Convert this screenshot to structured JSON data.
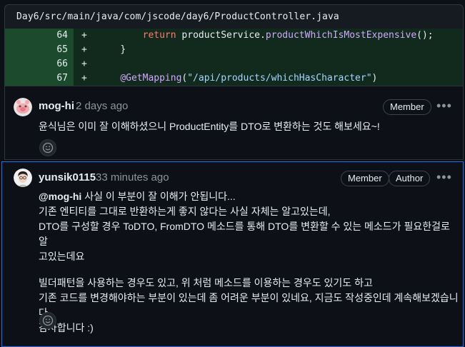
{
  "file": {
    "path": "Day6/src/main/java/com/jscode/day6/ProductController.java"
  },
  "diff": {
    "rows": [
      {
        "line": "64",
        "sign": "+",
        "indent": "        ",
        "tokens": [
          "return",
          " productService.",
          "productWhichIsMostExpensive",
          "();"
        ]
      },
      {
        "line": "65",
        "sign": "+",
        "indent": "    ",
        "tokens": [
          "}"
        ]
      },
      {
        "line": "66",
        "sign": "+",
        "indent": "",
        "tokens": [
          ""
        ]
      },
      {
        "line": "67",
        "sign": "+",
        "indent": "    ",
        "tokens": [
          "@GetMapping",
          "(",
          "\"/api/products/whichHasCharacter\"",
          ")"
        ]
      }
    ],
    "line_64": "64",
    "line_65": "65",
    "line_66": "66",
    "line_67": "67",
    "sign": "+",
    "r64_kw": "return",
    "r64_a": " productService.",
    "r64_fn": "productWhichIsMostExpensive",
    "r64_b": "();",
    "r65": "}",
    "r67_an": "@GetMapping",
    "r67_a": "(",
    "r67_str": "\"/api/products/whichHasCharacter\"",
    "r67_b": ")"
  },
  "comments": [
    {
      "author": "mog-hi",
      "time": "2 days ago",
      "badges": [
        "Member"
      ],
      "body": "윤식님은 이미 잘 이해하셨으니 ProductEntity를 DTO로 변환하는 것도 해보세요~!"
    },
    {
      "author": "yunsik0115",
      "time": "33 minutes ago",
      "badges": [
        "Member",
        "Author"
      ],
      "mention": "@mog-hi",
      "p1_l1": " 사실 이 부분이 잘 이해가 안됩니다...",
      "p1_l2": "기존 엔티티를 그대로 반환하는게 좋지 않다는 사실 자체는 알고있는데,",
      "p1_l3": "DTO를 구성할 경우 ToDTO, FromDTO 메소드를 통해 DTO를 변환할 수 있는 메소드가 필요한걸로 알",
      "p1_l4": "고있는데요",
      "p2_l1": "빌더패턴을 사용하는 경우도 있고, 위 처럼 메소드를 이용하는 경우도 있기도 하고",
      "p2_l2": "기존 코드를 변경해야하는 부분이 있는데 좀 어려운 부분이 있네요, 지금도 작성중인데 계속해보겠습니다",
      "p2_l3": "감사합니다 :)"
    }
  ],
  "icons": {
    "more": "kebab-horizontal-icon",
    "reaction": "smiley-icon"
  },
  "colors": {
    "background": "#0d1117",
    "diff_added_bg": "#112a1d",
    "diff_added_gutter": "#1b4b2c",
    "focus_border": "#1f6feb",
    "muted": "#8b949e"
  }
}
